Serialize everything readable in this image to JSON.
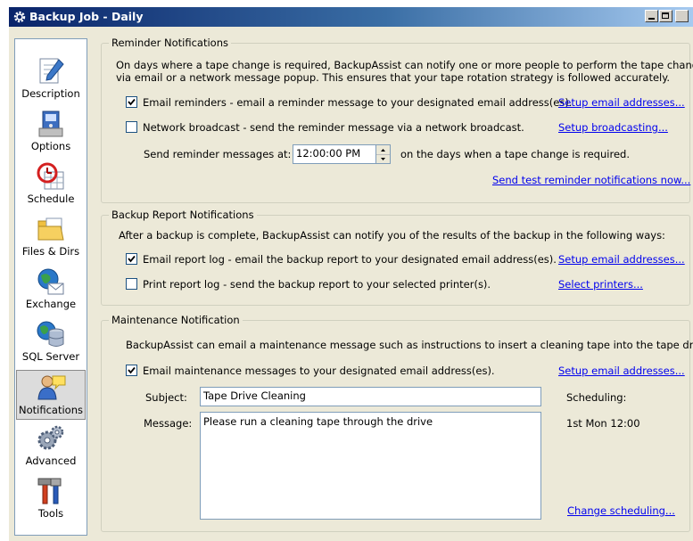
{
  "window": {
    "title": "Backup Job - Daily"
  },
  "sidebar": {
    "items": [
      {
        "label": "Description",
        "icon": "description-icon"
      },
      {
        "label": "Options",
        "icon": "options-icon"
      },
      {
        "label": "Schedule",
        "icon": "schedule-icon"
      },
      {
        "label": "Files & Dirs",
        "icon": "folder-icon"
      },
      {
        "label": "Exchange",
        "icon": "exchange-icon"
      },
      {
        "label": "SQL Server",
        "icon": "database-icon"
      },
      {
        "label": "Notifications",
        "icon": "notifications-icon",
        "selected": true
      },
      {
        "label": "Advanced",
        "icon": "gears-icon"
      },
      {
        "label": "Tools",
        "icon": "tools-icon"
      }
    ]
  },
  "reminder": {
    "legend": "Reminder Notifications",
    "desc_line1": "On days where a tape change is required, BackupAssist can notify one or more people to perform the tape change",
    "desc_line2": "via email or a network message popup. This ensures that your tape rotation strategy is followed accurately.",
    "email_label": "Email reminders - email a reminder message to your designated email address(es).",
    "email_checked": true,
    "email_link": "Setup email addresses...",
    "broadcast_label": "Network broadcast - send the reminder message via a network broadcast.",
    "broadcast_checked": false,
    "broadcast_link": "Setup broadcasting...",
    "send_at_label": "Send reminder messages at:",
    "send_at_value": "12:00:00 PM",
    "send_at_suffix": "on the days when a tape change is required.",
    "test_link": "Send test reminder notifications now..."
  },
  "report": {
    "legend": "Backup Report Notifications",
    "desc": "After a backup is complete, BackupAssist can notify you of the results of the backup in the following ways:",
    "email_label": "Email report log - email the backup report to your designated email address(es).",
    "email_checked": true,
    "email_link": "Setup email addresses...",
    "print_label": "Print report log - send the backup report to your selected printer(s).",
    "print_checked": false,
    "print_link": "Select printers..."
  },
  "maintenance": {
    "legend": "Maintenance Notification",
    "desc": "BackupAssist can email a maintenance message such as instructions to insert a cleaning tape into the tape drive.",
    "email_label": "Email maintenance messages to your designated email address(es).",
    "email_checked": true,
    "email_link": "Setup email addresses...",
    "subject_label": "Subject:",
    "subject_value": "Tape Drive Cleaning",
    "message_label": "Message:",
    "message_value": "Please run a cleaning tape through the drive",
    "scheduling_label": "Scheduling:",
    "scheduling_value": "1st Mon 12:00",
    "change_link": "Change scheduling..."
  }
}
